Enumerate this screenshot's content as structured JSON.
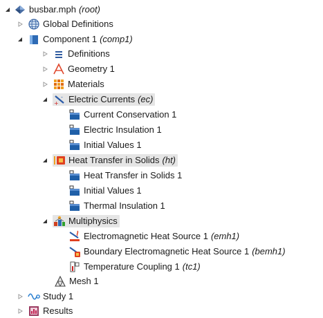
{
  "tree": {
    "root": {
      "label": "busbar.mph",
      "sub": "(root)",
      "icon": "model-icon"
    },
    "global_definitions": {
      "label": "Global Definitions",
      "icon": "globe-icon"
    },
    "component": {
      "label": "Component 1",
      "sub": "(comp1)",
      "icon": "component-icon"
    },
    "definitions": {
      "label": "Definitions",
      "icon": "definitions-icon"
    },
    "geometry": {
      "label": "Geometry 1",
      "icon": "geometry-icon"
    },
    "materials": {
      "label": "Materials",
      "icon": "materials-icon"
    },
    "electric_currents": {
      "label": "Electric Currents",
      "sub": "(ec)",
      "icon": "electric-currents-icon",
      "children": [
        {
          "label": "Current Conservation 1"
        },
        {
          "label": "Electric Insulation 1"
        },
        {
          "label": "Initial Values 1"
        }
      ]
    },
    "heat_transfer": {
      "label": "Heat Transfer in Solids",
      "sub": "(ht)",
      "icon": "heat-transfer-icon",
      "children": [
        {
          "label": "Heat Transfer in Solids 1"
        },
        {
          "label": "Initial Values 1"
        },
        {
          "label": "Thermal Insulation 1"
        }
      ]
    },
    "multiphysics": {
      "label": "Multiphysics",
      "icon": "multiphysics-icon",
      "children": [
        {
          "label": "Electromagnetic Heat Source 1",
          "sub": "(emh1)"
        },
        {
          "label": "Boundary Electromagnetic Heat Source 1",
          "sub": "(bemh1)"
        },
        {
          "label": "Temperature Coupling 1",
          "sub": "(tc1)"
        }
      ]
    },
    "mesh": {
      "label": "Mesh 1",
      "icon": "mesh-icon"
    },
    "study": {
      "label": "Study 1",
      "icon": "study-icon"
    },
    "results": {
      "label": "Results",
      "icon": "results-icon"
    }
  },
  "colors": {
    "highlight": "#e5e5e5",
    "arrow_collapsed": "#9a9a9a",
    "arrow_expanded": "#333333",
    "node_blue": "#1f5fa8"
  }
}
